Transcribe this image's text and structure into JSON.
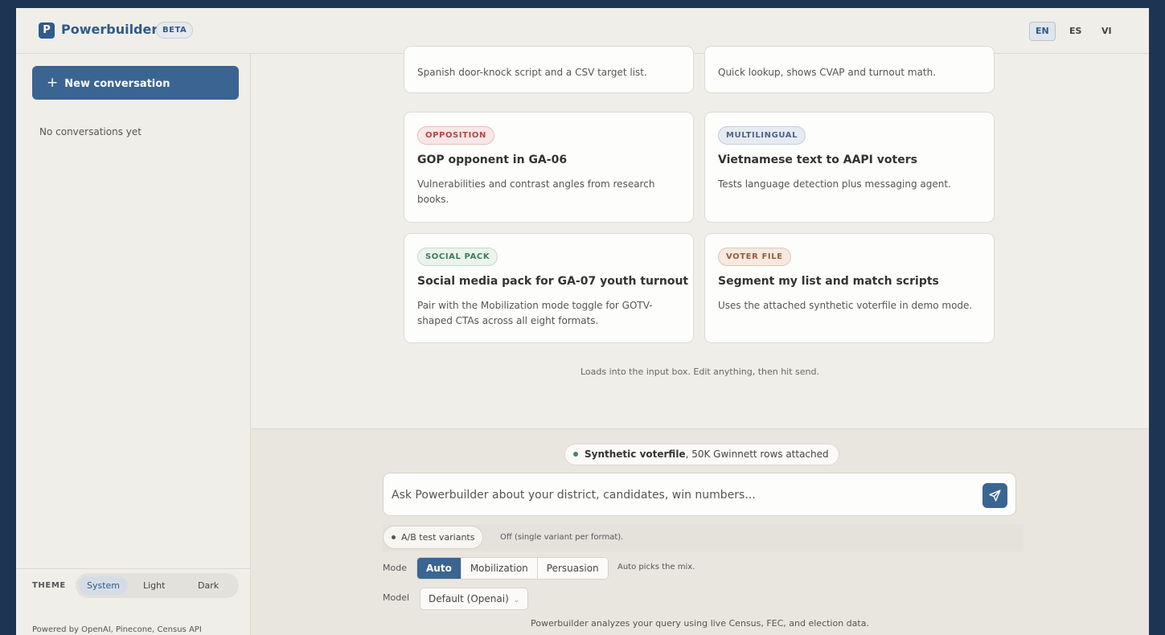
{
  "header": {
    "logo_letter": "P",
    "brand": "Powerbuilder",
    "beta": "BETA",
    "languages": [
      "EN",
      "ES",
      "VI"
    ]
  },
  "sidebar": {
    "new_conversation": "New conversation",
    "empty_text": "No conversations yet",
    "theme_label": "THEME",
    "theme_options": [
      "System",
      "Light",
      "Dark"
    ],
    "theme_selected": "System",
    "powered_by": "Powered by OpenAI, Pinecone, Census API"
  },
  "cards": [
    {
      "desc": "Spanish door-knock script and a CSV target list."
    },
    {
      "desc": "Quick lookup, shows CVAP and turnout math."
    },
    {
      "tag": "OPPOSITION",
      "title": "GOP opponent in GA-06",
      "desc": "Vulnerabilities and contrast angles from research books."
    },
    {
      "tag": "MULTILINGUAL",
      "title": "Vietnamese text to AAPI voters",
      "desc": "Tests language detection plus messaging agent."
    },
    {
      "tag": "SOCIAL PACK",
      "title": "Social media pack for GA-07 youth turnout",
      "desc": "Pair with the Mobilization mode toggle for GOTV-shaped CTAs across all eight formats."
    },
    {
      "tag": "VOTER FILE",
      "title": "Segment my list and match scripts",
      "desc": "Uses the attached synthetic voterfile in demo mode."
    }
  ],
  "hint": "Loads into the input box. Edit anything, then hit send.",
  "composer": {
    "voterfile_bold": "Synthetic voterfile",
    "voterfile_rest": ", 50K Gwinnett rows attached",
    "placeholder": "Ask Powerbuilder about your district, candidates, win numbers...",
    "ab_label": "A/B test variants",
    "ab_status": "Off (single variant per format).",
    "mode_label": "Mode",
    "modes": [
      "Auto",
      "Mobilization",
      "Persuasion"
    ],
    "mode_selected": "Auto",
    "mode_hint": "Auto picks the mix.",
    "model_label": "Model",
    "model_value": "Default (Openai)",
    "footer": "Powerbuilder analyzes your query using live Census, FEC, and election data."
  }
}
